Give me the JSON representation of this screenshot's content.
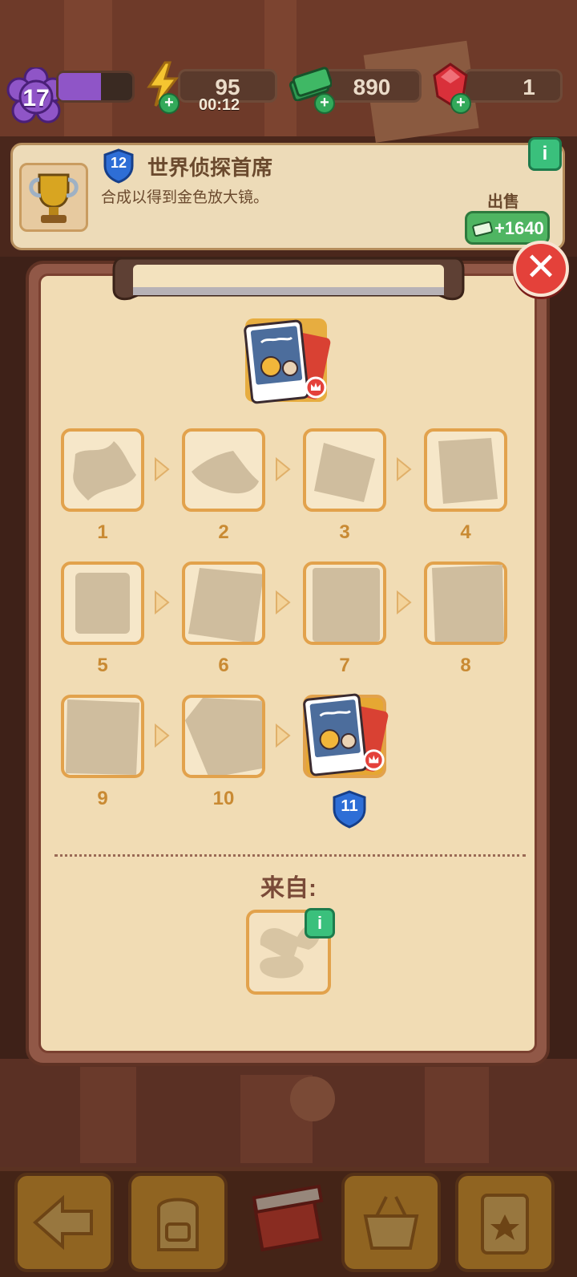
{
  "header": {
    "level": "17",
    "xp_progress": 0.58,
    "energy": "95",
    "energy_timer": "00:12",
    "cash": "890",
    "gems": "1"
  },
  "quest": {
    "badge_level": "12",
    "title": "世界侦探首席",
    "description": "合成以得到金色放大镜。",
    "sell_label": "出售",
    "sell_value": "+1640",
    "info_icon": "info-icon"
  },
  "panel": {
    "close_icon": "close-icon",
    "top_item": "detective-photo-card",
    "chain": [
      {
        "label": "1"
      },
      {
        "label": "2"
      },
      {
        "label": "3"
      },
      {
        "label": "4"
      },
      {
        "label": "5"
      },
      {
        "label": "6"
      },
      {
        "label": "7"
      },
      {
        "label": "8"
      },
      {
        "label": "9"
      },
      {
        "label": "10"
      }
    ],
    "final_item_level": "11",
    "from_label": "来自:",
    "source_item": "gramophone-silhouette"
  },
  "toolbar": {
    "buttons": [
      "back-arrow-icon",
      "backpack-icon",
      "gift-box-icon",
      "basket-icon",
      "clipboard-icon"
    ]
  },
  "colors": {
    "board_bg": "#f1dcb4",
    "slot_border": "#e2a24c",
    "number_color": "#c98a33",
    "close_red": "#e4413a",
    "info_green": "#3ac07c"
  }
}
